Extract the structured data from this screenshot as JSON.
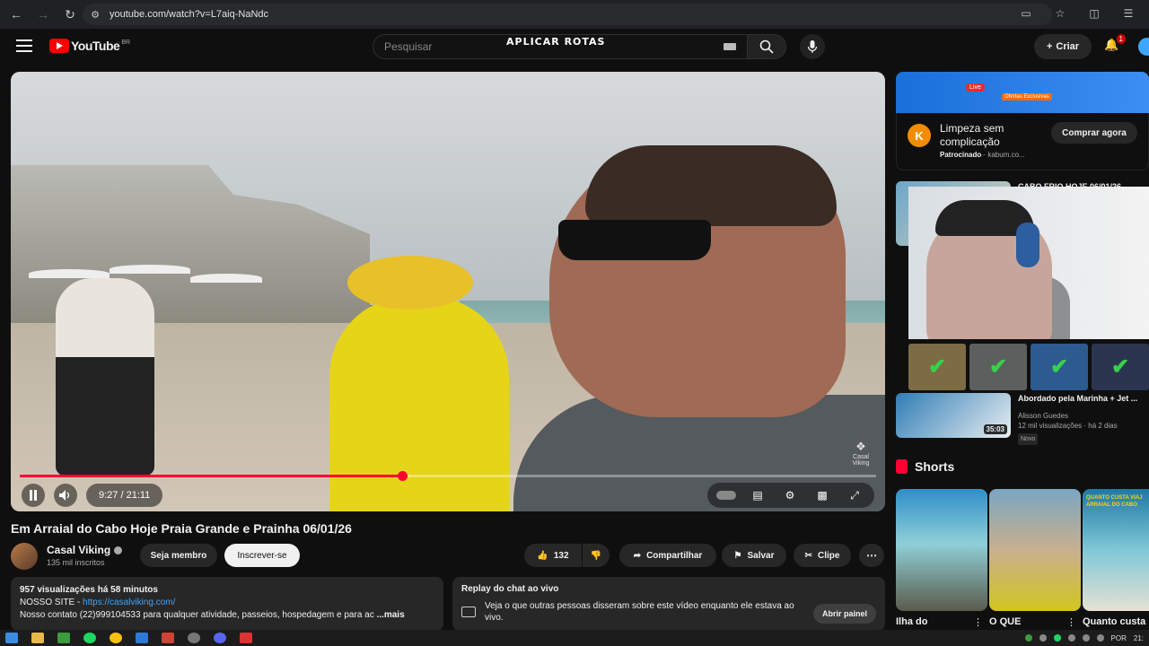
{
  "browser": {
    "url": "youtube.com/watch?v=L7aiq-NaNdc"
  },
  "header": {
    "logo_text": "YouTube",
    "country_code": "BR",
    "search_placeholder": "Pesquisar",
    "overlay_text": "APLICAR ROTAS",
    "create_label": "Criar",
    "notification_count": "1"
  },
  "player": {
    "time": "9:27 / 21:11",
    "progress_fraction": 0.447,
    "watermark": "Casal Viking"
  },
  "video": {
    "title": "Em Arraial do Cabo Hoje Praia Grande e Prainha 06/01/26",
    "channel": "Casal Viking",
    "subscribers": "135 mil inscritos",
    "member_label": "Seja membro",
    "subscribe_label": "Inscrever-se",
    "likes": "132",
    "share_label": "Compartilhar",
    "save_label": "Salvar",
    "clip_label": "Clipe"
  },
  "description": {
    "meta": "957 visualizações  há 58 minutos",
    "site_label": "NOSSO SITE - ",
    "site_link": "https://casalviking.com/",
    "contact": "Nosso contato (22)999104533 para qualquer atividade, passeios, hospedagem e para ac",
    "more": "...mais"
  },
  "chat_replay": {
    "title": "Replay do chat ao vivo",
    "body": "Veja o que outras pessoas disseram sobre este vídeo enquanto ele estava ao vivo.",
    "open_label": "Abrir painel"
  },
  "ad": {
    "title": "Limpeza sem complicação",
    "sponsored": "Patrocinado",
    "domain": "kabum.co...",
    "cta": "Comprar agora",
    "logo_letter": "K",
    "banner_live": "Live",
    "banner_offer": "Ofertas Exclusivas"
  },
  "recommendations": [
    {
      "title": "CABO FRIO HOJE 06/01/26",
      "channel": "",
      "views": "",
      "duration": ""
    },
    {
      "title": "Abordado pela Marinha + Jet ...",
      "channel": "Alisson Guedes",
      "views": "12 mil visualizações · há 2 dias",
      "duration": "35:03",
      "badge": "Novo"
    }
  ],
  "shorts": {
    "heading": "Shorts",
    "items": [
      {
        "title": "Ilha do"
      },
      {
        "title": "O QUE"
      },
      {
        "title": "Quanto custa"
      }
    ],
    "third_overlay": "QUANTO CUSTA VIAJ ARRAIAL DO CABO"
  },
  "taskbar": {
    "language": "POR",
    "clock": "21:"
  },
  "colors": {
    "accent": "#ff0033",
    "link": "#3ea6ff",
    "background": "#0f0f0f"
  }
}
